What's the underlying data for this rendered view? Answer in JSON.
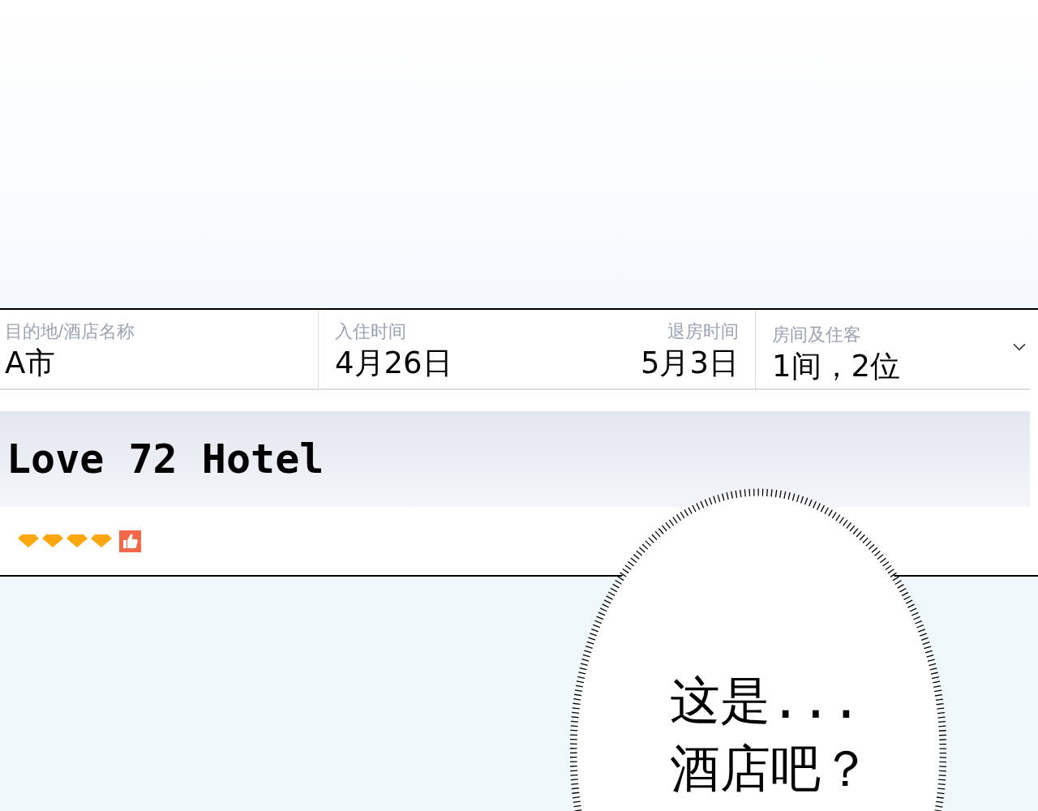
{
  "search_bar": {
    "destination": {
      "label": "目的地/酒店名称",
      "value": "A市"
    },
    "check_in": {
      "label": "入住时间",
      "value": "4月26日"
    },
    "check_out": {
      "label": "退房时间",
      "value": "5月3日"
    },
    "rooms_guests": {
      "label": "房间及住客",
      "value": "1间，2位"
    }
  },
  "hotel": {
    "name": "Love 72 Hotel",
    "stars": 4
  },
  "speech_bubble": {
    "lines": [
      "这是...",
      "酒店吧？"
    ]
  }
}
